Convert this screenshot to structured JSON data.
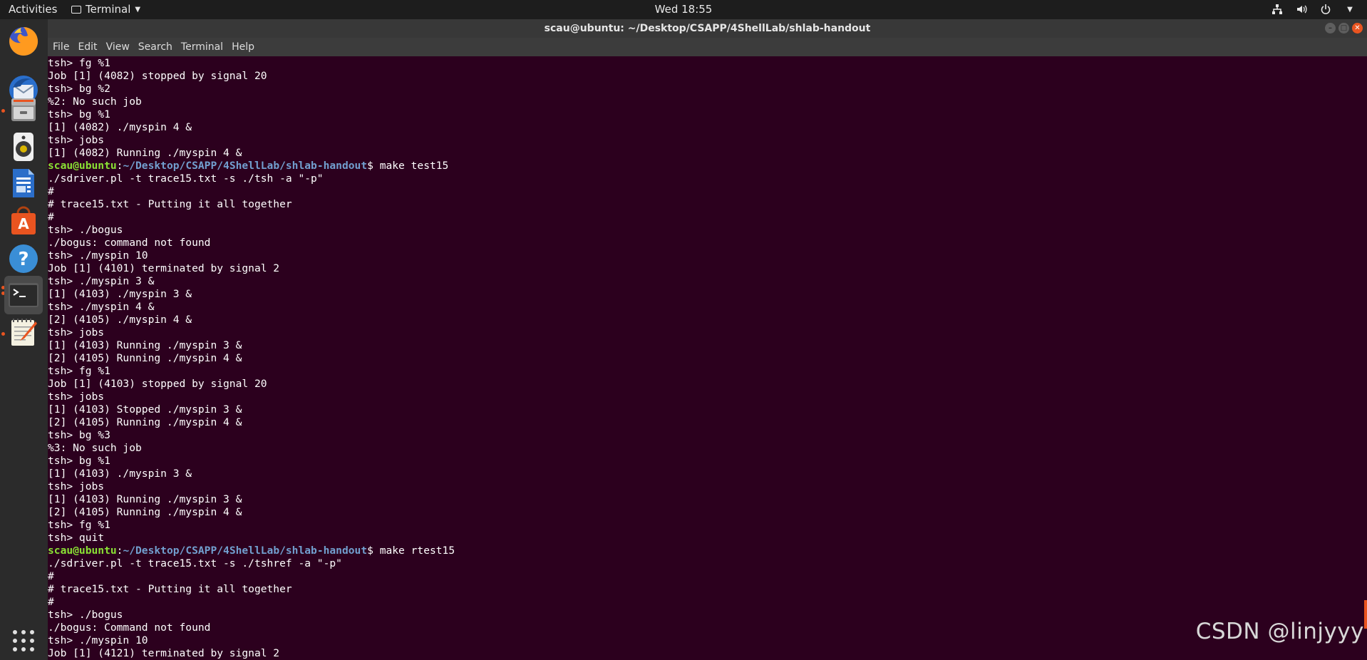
{
  "topbar": {
    "activities": "Activities",
    "app_menu": "Terminal",
    "clock": "Wed 18:55"
  },
  "window": {
    "title": "scau@ubuntu: ~/Desktop/CSAPP/4ShellLab/shlab-handout"
  },
  "menu": [
    "File",
    "Edit",
    "View",
    "Search",
    "Terminal",
    "Help"
  ],
  "dock": [
    {
      "name": "firefox-icon",
      "running": false
    },
    {
      "name": "thunderbird-icon",
      "running": false
    },
    {
      "name": "files-icon",
      "running": true
    },
    {
      "name": "rhythmbox-icon",
      "running": false
    },
    {
      "name": "libreoffice-writer-icon",
      "running": false
    },
    {
      "name": "software-center-icon",
      "running": false
    },
    {
      "name": "help-icon",
      "running": false
    },
    {
      "name": "terminal-icon",
      "running": true
    },
    {
      "name": "text-editor-icon",
      "running": true
    },
    {
      "name": "show-applications-icon",
      "running": false
    }
  ],
  "prompt": {
    "user": "scau@ubuntu",
    "path": "~/Desktop/CSAPP/4ShellLab/shlab-handout"
  },
  "terminal_lines": [
    {
      "text": "tsh> fg %1"
    },
    {
      "text": "Job [1] (4082) stopped by signal 20"
    },
    {
      "text": "tsh> bg %2"
    },
    {
      "text": "%2: No such job"
    },
    {
      "text": "tsh> bg %1"
    },
    {
      "text": "[1] (4082) ./myspin 4 &"
    },
    {
      "text": "tsh> jobs"
    },
    {
      "text": "[1] (4082) Running ./myspin 4 &"
    },
    {
      "prompt": true,
      "cmd": "$ make test15"
    },
    {
      "text": "./sdriver.pl -t trace15.txt -s ./tsh -a \"-p\""
    },
    {
      "text": "#"
    },
    {
      "text": "# trace15.txt - Putting it all together"
    },
    {
      "text": "#"
    },
    {
      "text": "tsh> ./bogus"
    },
    {
      "text": "./bogus: command not found"
    },
    {
      "text": "tsh> ./myspin 10"
    },
    {
      "text": "Job [1] (4101) terminated by signal 2"
    },
    {
      "text": "tsh> ./myspin 3 &"
    },
    {
      "text": "[1] (4103) ./myspin 3 &"
    },
    {
      "text": "tsh> ./myspin 4 &"
    },
    {
      "text": "[2] (4105) ./myspin 4 &"
    },
    {
      "text": "tsh> jobs"
    },
    {
      "text": "[1] (4103) Running ./myspin 3 &"
    },
    {
      "text": "[2] (4105) Running ./myspin 4 &"
    },
    {
      "text": "tsh> fg %1"
    },
    {
      "text": "Job [1] (4103) stopped by signal 20"
    },
    {
      "text": "tsh> jobs"
    },
    {
      "text": "[1] (4103) Stopped ./myspin 3 &"
    },
    {
      "text": "[2] (4105) Running ./myspin 4 &"
    },
    {
      "text": "tsh> bg %3"
    },
    {
      "text": "%3: No such job"
    },
    {
      "text": "tsh> bg %1"
    },
    {
      "text": "[1] (4103) ./myspin 3 &"
    },
    {
      "text": "tsh> jobs"
    },
    {
      "text": "[1] (4103) Running ./myspin 3 &"
    },
    {
      "text": "[2] (4105) Running ./myspin 4 &"
    },
    {
      "text": "tsh> fg %1"
    },
    {
      "text": "tsh> quit"
    },
    {
      "prompt": true,
      "cmd": "$ make rtest15"
    },
    {
      "text": "./sdriver.pl -t trace15.txt -s ./tshref -a \"-p\""
    },
    {
      "text": "#"
    },
    {
      "text": "# trace15.txt - Putting it all together"
    },
    {
      "text": "#"
    },
    {
      "text": "tsh> ./bogus"
    },
    {
      "text": "./bogus: Command not found"
    },
    {
      "text": "tsh> ./myspin 10"
    },
    {
      "text": "Job [1] (4121) terminated by signal 2"
    }
  ],
  "watermark": "CSDN @linjyyy",
  "colors": {
    "terminal_bg": "#2c001e",
    "prompt_user": "#8ae234",
    "prompt_path": "#729fcf",
    "accent": "#e95420"
  }
}
